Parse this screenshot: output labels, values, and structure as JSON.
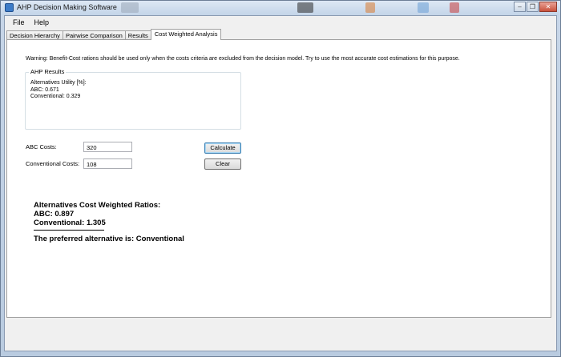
{
  "window": {
    "title": "AHP Decision Making Software"
  },
  "menu": {
    "items": [
      "File",
      "Help"
    ]
  },
  "tabs": [
    "Decision Hierarchy",
    "Pairwise Comparison",
    "Results",
    "Cost Weighted Analysis"
  ],
  "active_tab": "Cost Weighted Analysis",
  "warning_text": "Warning: Benefit-Cost rations should be used only when the costs criteria are excluded from the decision model. Try to use the most accurate cost estimations for this purpose.",
  "ahp_results": {
    "group_title": "AHP Results",
    "lines": [
      "Alternatives Utility [%]:",
      "ABC: 0.671",
      "Conventional: 0.329"
    ]
  },
  "costs": {
    "abc_label": "ABC Costs:",
    "abc_value": "320",
    "conventional_label": "Conventional Costs:",
    "conventional_value": "108"
  },
  "buttons": {
    "calculate": "Calculate",
    "clear": "Clear"
  },
  "output": {
    "heading": "Alternatives Cost Weighted Ratios:",
    "abc": "ABC: 0.897",
    "conventional": "Conventional: 1.305",
    "preferred": "The preferred alternative is: Conventional"
  }
}
